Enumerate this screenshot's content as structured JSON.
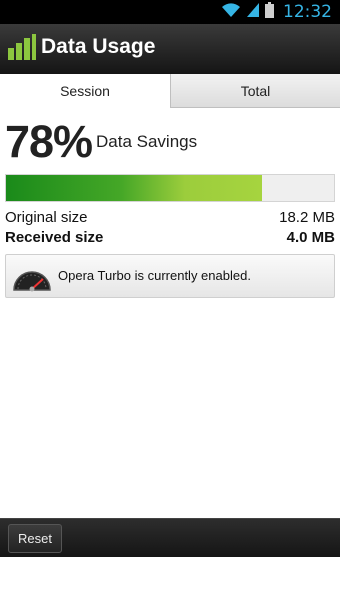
{
  "status_bar": {
    "time": "12:32"
  },
  "app": {
    "title": "Data Usage"
  },
  "tabs": [
    {
      "label": "Session"
    },
    {
      "label": "Total"
    }
  ],
  "savings": {
    "percent_text": "78%",
    "label": "Data Savings",
    "percent_value": 78
  },
  "sizes": {
    "original_label": "Original size",
    "original_value": "18.2 MB",
    "received_label": "Received size",
    "received_value": "4.0 MB"
  },
  "turbo": {
    "message": "Opera Turbo is currently enabled."
  },
  "footer": {
    "reset_label": "Reset"
  },
  "colors": {
    "accent": "#36b5e5",
    "bar_start": "#1a8a1a",
    "bar_end": "#a6d43f"
  },
  "icons": [
    "wifi-icon",
    "signal-icon",
    "battery-icon",
    "bar-chart-icon",
    "speedometer-icon"
  ]
}
